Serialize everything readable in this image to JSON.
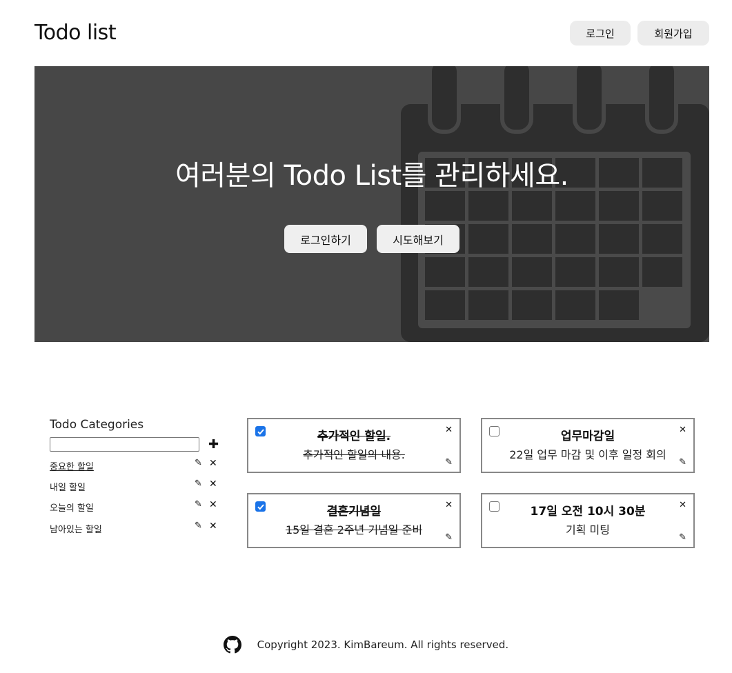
{
  "header": {
    "title": "Todo list",
    "login_label": "로그인",
    "signup_label": "회원가입"
  },
  "hero": {
    "title": "여러분의 Todo List를 관리하세요.",
    "login_button": "로그인하기",
    "try_button": "시도해보기",
    "background_color": "#474747"
  },
  "categories": {
    "title": "Todo Categories",
    "input_value": "",
    "add_icon": "plus-icon",
    "items": [
      {
        "label": "중요한 할일",
        "selected": true
      },
      {
        "label": "내일 할일",
        "selected": false
      },
      {
        "label": "오늘의 할일",
        "selected": false
      },
      {
        "label": "남아있는 할일",
        "selected": false
      }
    ],
    "edit_icon": "pencil-icon",
    "delete_icon": "close-icon"
  },
  "todos": [
    {
      "title": "추가적인 할일.",
      "body": "추가적인 할일의 내용.",
      "done": true
    },
    {
      "title": "업무마감일",
      "body": "22일 업무 마감 및 이후 일정 회의",
      "done": false
    },
    {
      "title": "결혼기념일",
      "body": "15일 결혼 2주년 기념일 준비",
      "done": true
    },
    {
      "title": "17일 오전 10시 30분",
      "body": "기획 미팅",
      "done": false
    }
  ],
  "footer": {
    "icon": "github-icon",
    "copyright": "Copyright 2023. KimBareum. All rights reserved."
  },
  "colors": {
    "checkbox_checked": "#1a73e8",
    "card_border": "#888888",
    "button_bg": "#ececec"
  }
}
